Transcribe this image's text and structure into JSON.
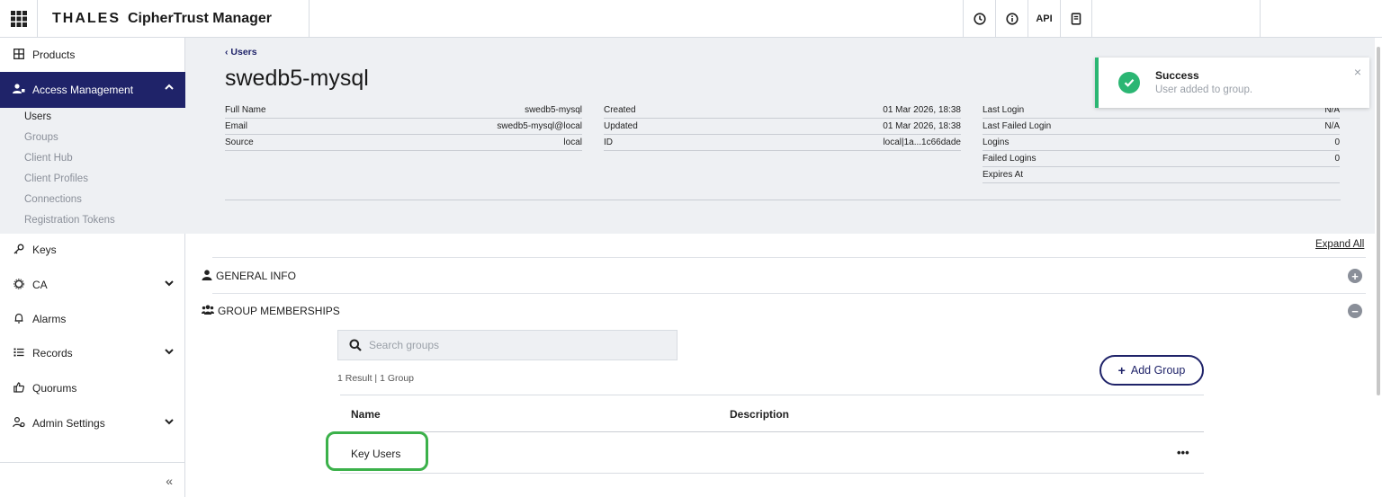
{
  "topbar": {
    "brand_thales": "THALES",
    "brand_product": "CipherTrust Manager",
    "api_label": "API",
    "icons": [
      "apps-grid-icon",
      "clock-icon",
      "info-icon",
      "api",
      "book-icon"
    ]
  },
  "sidebar": {
    "products": "Products",
    "access_management": "Access Management",
    "sub_items": [
      "Users",
      "Groups",
      "Client Hub",
      "Client Profiles",
      "Connections",
      "Registration Tokens"
    ],
    "keys": "Keys",
    "ca": "CA",
    "alarms": "Alarms",
    "records": "Records",
    "quorums": "Quorums",
    "admin_settings": "Admin Settings",
    "collapse": "«"
  },
  "header": {
    "back": "‹ Users",
    "title": "swedb5-mysql",
    "col1": [
      {
        "k": "Full Name",
        "v": "swedb5-mysql"
      },
      {
        "k": "Email",
        "v": "swedb5-mysql@local"
      },
      {
        "k": "Source",
        "v": "local"
      }
    ],
    "col2": [
      {
        "k": "Created",
        "v": "01 Mar 2026, 18:38"
      },
      {
        "k": "Updated",
        "v": "01 Mar 2026, 18:38"
      },
      {
        "k": "ID",
        "v": "local|1a...1c66dade"
      }
    ],
    "col3": [
      {
        "k": "Last Login",
        "v": "N/A"
      },
      {
        "k": "Last Failed Login",
        "v": "N/A"
      },
      {
        "k": "Logins",
        "v": "0"
      },
      {
        "k": "Failed Logins",
        "v": "0"
      },
      {
        "k": "Expires At",
        "v": ""
      }
    ]
  },
  "toast": {
    "title": "Success",
    "message": "User added to group.",
    "close": "×",
    "accent": "#2bb673"
  },
  "content": {
    "expand_all": "Expand All",
    "general_info": "GENERAL INFO",
    "group_memberships": "GROUP MEMBERSHIPS",
    "search_placeholder": "Search groups",
    "result_count": "1 Result | 1 Group",
    "add_group": "Add Group",
    "columns": [
      "Name",
      "Description"
    ],
    "rows": [
      {
        "name": "Key Users",
        "description": "",
        "more": "•••"
      }
    ]
  },
  "colors": {
    "primary": "#1f2369",
    "header_bg": "#eef0f3",
    "highlight": "#3bb14a"
  }
}
